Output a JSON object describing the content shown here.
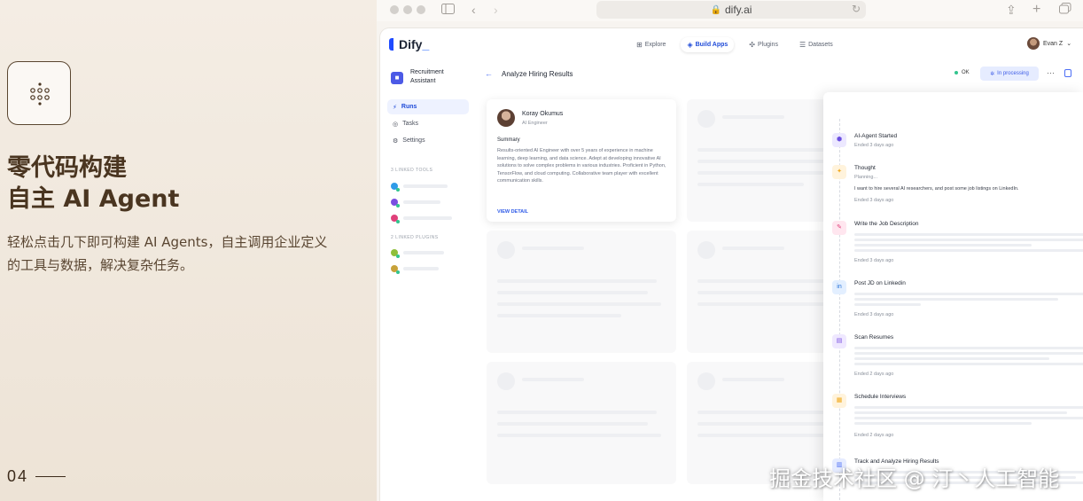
{
  "promo": {
    "title_line1": "零代码构建",
    "title_line2": "自主 AI Agent",
    "description": "轻松点击几下即可构建 AI Agents，自主调用企业定义的工具与数据，解决复杂任务。",
    "page_number": "04"
  },
  "browser": {
    "url": "dify.ai"
  },
  "app": {
    "logo": "Dify",
    "logo_suffix": "_",
    "nav": [
      {
        "label": "Explore",
        "icon": "grid-icon"
      },
      {
        "label": "Build Apps",
        "icon": "cube-icon",
        "active": true
      },
      {
        "label": "Plugins",
        "icon": "puzzle-icon"
      },
      {
        "label": "Datasets",
        "icon": "database-icon"
      }
    ],
    "user_name": "Evan Z",
    "sidebar": {
      "app_name_line1": "Recruitment",
      "app_name_line2": "Assistant",
      "items": [
        {
          "label": "Runs",
          "active": true
        },
        {
          "label": "Tasks"
        },
        {
          "label": "Settings"
        }
      ],
      "tools_label": "3 LINKED TOOLS",
      "plugins_label": "2 LINKED PLUGINS"
    },
    "main": {
      "title": "Analyze Hiring Results",
      "status_ok": "OK",
      "processing": "In processing"
    },
    "profile": {
      "name": "Koray Okumus",
      "role": "AI Engineer",
      "summary_label": "Summary",
      "summary_text": "Results-oriented AI Engineer with over 5 years of experience in machine learning, deep learning, and data science. Adept at developing innovative AI solutions to solve complex problems in various industries. Proficient in Python, TensorFlow, and cloud computing. Collaborative team player with excellent communication skills.",
      "link": "VIEW DETAIL"
    },
    "log": [
      {
        "title": "AI-Agent Started",
        "time": "Ended 3 days ago",
        "icon": "agent-icon",
        "color": "#6b4fe0"
      },
      {
        "title": "Thought",
        "body1": "Planning...",
        "body2": "I want to hire several AI researchers, and post some job listings on LinkedIn.",
        "time": "Ended 3 days ago",
        "icon": "lightbulb-icon",
        "color": "#f0a81c"
      },
      {
        "title": "Write the Job Description",
        "time": "Ended 3 days ago",
        "icon": "pen-icon",
        "color": "#e0407a"
      },
      {
        "title": "Post JD on Linkedin",
        "time": "Ended 3 days ago",
        "icon": "linkedin-icon",
        "color": "#1f6fd8"
      },
      {
        "title": "Scan Resumes",
        "time": "Ended 2 days ago",
        "icon": "document-icon",
        "color": "#7a4fe0"
      },
      {
        "title": "Schedule Interviews",
        "time": "Ended 2 days ago",
        "icon": "calendar-icon",
        "color": "#f0a81c"
      },
      {
        "title": "Track and Analyze Hiring Results",
        "icon": "chart-icon",
        "color": "#4c6ef5"
      }
    ]
  },
  "watermark": "掘金技术社区 @ 汀丶人工智能"
}
